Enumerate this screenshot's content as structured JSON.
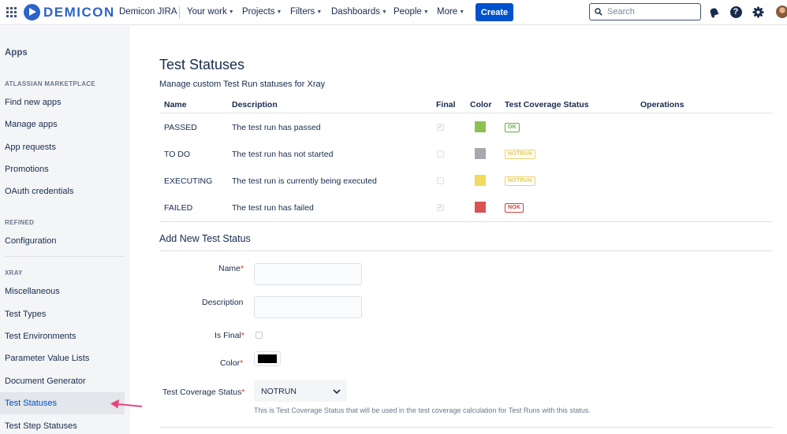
{
  "topnav": {
    "logo_text": "DEMICON",
    "site_name": "Demicon JIRA",
    "menu": [
      {
        "label": "Your work"
      },
      {
        "label": "Projects"
      },
      {
        "label": "Filters"
      },
      {
        "label": "Dashboards"
      },
      {
        "label": "People"
      },
      {
        "label": "More"
      }
    ],
    "create_label": "Create",
    "search_placeholder": "Search",
    "icons": [
      "app-switcher-icon",
      "notifications-icon",
      "help-icon",
      "settings-icon",
      "avatar"
    ]
  },
  "sidebar": {
    "heading": "Apps",
    "sections": [
      {
        "title": "ATLASSIAN MARKETPLACE",
        "items": [
          "Find new apps",
          "Manage apps",
          "App requests",
          "Promotions",
          "OAuth credentials"
        ]
      },
      {
        "title": "REFINED",
        "items": [
          "Configuration"
        ]
      },
      {
        "title": "XRAY",
        "items": [
          "Miscellaneous",
          "Test Types",
          "Test Environments",
          "Parameter Value Lists",
          "Document Generator",
          "Test Statuses",
          "Test Step Statuses"
        ]
      }
    ],
    "active_item": "Test Statuses"
  },
  "main": {
    "title": "Test Statuses",
    "description": "Manage custom Test Run statuses for Xray",
    "columns": [
      "Name",
      "Description",
      "Final",
      "Color",
      "Test Coverage Status",
      "Operations"
    ],
    "rows": [
      {
        "name": "PASSED",
        "description": "The test run has passed",
        "final": true,
        "color": "#8cc152",
        "coverage": "OK",
        "coverage_kind": "ok"
      },
      {
        "name": "TO DO",
        "description": "The test run has not started",
        "final": false,
        "color": "#a5a9ae",
        "coverage": "NOTRUN",
        "coverage_kind": "notrun"
      },
      {
        "name": "EXECUTING",
        "description": "The test run is currently being executed",
        "final": false,
        "color": "#f0d95c",
        "coverage": "NOTRUN",
        "coverage_kind": "notrun"
      },
      {
        "name": "FAILED",
        "description": "The test run has failed",
        "final": true,
        "color": "#d9534f",
        "coverage": "NOK",
        "coverage_kind": "nok"
      }
    ]
  },
  "form": {
    "title": "Add New Test Status",
    "name_label": "Name",
    "description_label": "Description",
    "is_final_label": "Is Final",
    "color_label": "Color",
    "color_value": "#000000",
    "coverage_label": "Test Coverage Status",
    "coverage_value": "NOTRUN",
    "coverage_help": "This is Test Coverage Status that will be used in the test coverage calculation for Test Runs with this status.",
    "required_mark": "*"
  },
  "colors": {
    "accent": "#0052cc",
    "annotation_arrow": "#e8457a"
  }
}
